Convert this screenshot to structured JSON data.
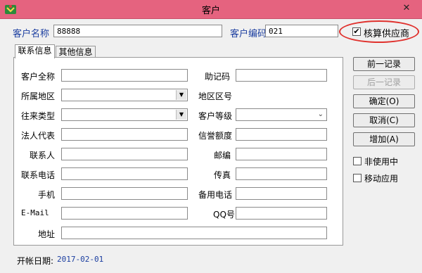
{
  "window": {
    "title": "客户",
    "close_glyph": "✕"
  },
  "header": {
    "name_label": "客户名称",
    "name_value": "88888",
    "code_label": "客户编码",
    "code_value": "021",
    "supplier_checkbox_label": "核算供应商",
    "supplier_checked": true,
    "check_glyph": "✔"
  },
  "tabs": [
    {
      "label": "联系信息",
      "active": true
    },
    {
      "label": "其他信息",
      "active": false
    }
  ],
  "form": {
    "full_name": {
      "label": "客户全称",
      "value": ""
    },
    "mnemonic": {
      "label": "助记码",
      "value": ""
    },
    "region": {
      "label": "所属地区",
      "value": ""
    },
    "region_code": {
      "label": "地区区号"
    },
    "contact_type": {
      "label": "往来类型",
      "value": ""
    },
    "customer_level": {
      "label": "客户等级",
      "value": ""
    },
    "legal_rep": {
      "label": "法人代表",
      "value": ""
    },
    "credit_limit": {
      "label": "信誉额度",
      "value": ""
    },
    "contact_person": {
      "label": "联系人",
      "value": ""
    },
    "postcode": {
      "label": "邮编",
      "value": ""
    },
    "phone": {
      "label": "联系电话",
      "value": ""
    },
    "fax": {
      "label": "传真",
      "value": ""
    },
    "mobile": {
      "label": "手机",
      "value": ""
    },
    "backup_phone": {
      "label": "备用电话",
      "value": ""
    },
    "email": {
      "label": "E-Mail",
      "value": ""
    },
    "qq": {
      "label": "QQ号",
      "value": ""
    },
    "address": {
      "label": "地址",
      "value": ""
    }
  },
  "buttons": {
    "prev": "前一记录",
    "next": "后一记录",
    "ok": "确定(O)",
    "cancel": "取消(C)",
    "add": "增加(A)"
  },
  "options": {
    "unused_label": "非使用中",
    "unused_checked": false,
    "mobile_app_label": "移动应用",
    "mobile_app_checked": false
  },
  "footer": {
    "open_date_label": "开帐日期:",
    "open_date_value": "2017-02-01"
  },
  "colors": {
    "titlebar": "#e5637f",
    "label_blue": "#1b3ea0",
    "highlight_red": "#e0312d"
  }
}
